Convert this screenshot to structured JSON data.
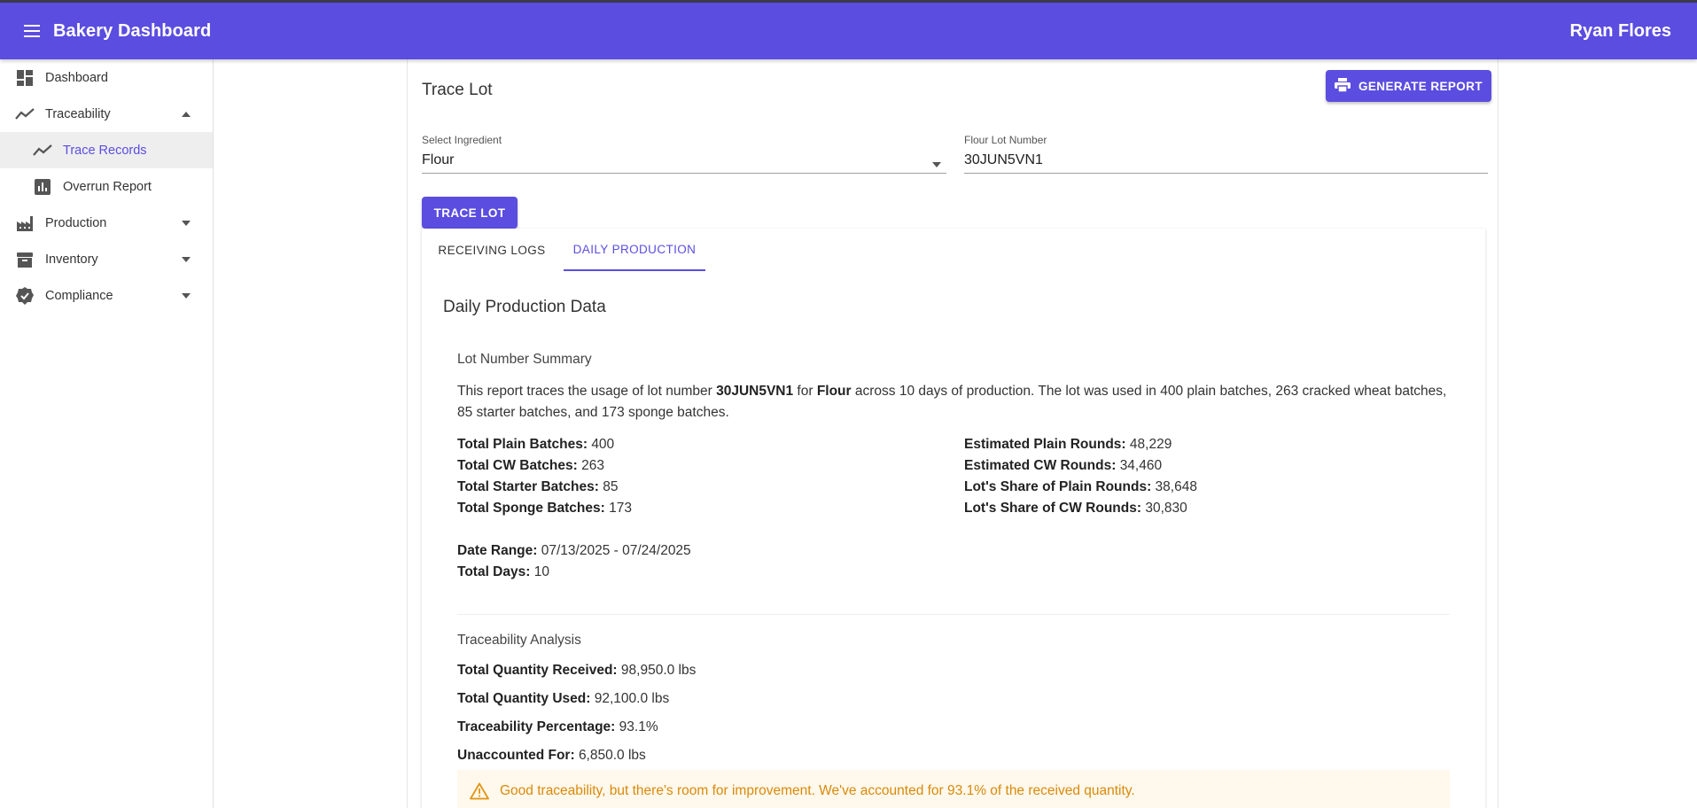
{
  "app": {
    "title": "Bakery Dashboard",
    "user": "Ryan Flores",
    "accent": "#5b4de0"
  },
  "sidebar": {
    "items": [
      {
        "label": "Dashboard",
        "icon": "dashboard-icon"
      },
      {
        "label": "Traceability",
        "icon": "timeline-icon",
        "expanded": true
      },
      {
        "label": "Trace Records",
        "icon": "timeline-icon",
        "active": true
      },
      {
        "label": "Overrun Report",
        "icon": "bar-chart-icon"
      },
      {
        "label": "Production",
        "icon": "factory-icon"
      },
      {
        "label": "Inventory",
        "icon": "archive-icon"
      },
      {
        "label": "Compliance",
        "icon": "verified-icon"
      }
    ]
  },
  "main": {
    "title": "Trace Lot",
    "generate_label": "GENERATE REPORT",
    "ingredient_label": "Select Ingredient",
    "ingredient_value": "Flour",
    "lot_label": "Flour Lot Number",
    "lot_value": "30JUN5VN1",
    "trace_label": "TRACE LOT",
    "tabs": [
      {
        "label": "RECEIVING LOGS",
        "active": false
      },
      {
        "label": "DAILY PRODUCTION",
        "active": true
      }
    ]
  },
  "report": {
    "title": "Daily Production Data",
    "summary_title": "Lot Number Summary",
    "summary": {
      "p1": "This report traces the usage of lot number ",
      "lot": "30JUN5VN1",
      "p2": " for ",
      "ingredient": "Flour",
      "p3": " across 10 days of production. The lot was used in 400 plain batches, 263 cracked wheat batches, 85 starter batches, and 173 sponge batches."
    },
    "left_stats": [
      {
        "label": "Total Plain Batches:",
        "value": "400"
      },
      {
        "label": "Total CW Batches:",
        "value": "263"
      },
      {
        "label": "Total Starter Batches:",
        "value": "85"
      },
      {
        "label": "Total Sponge Batches:",
        "value": "173"
      }
    ],
    "right_stats": [
      {
        "label": "Estimated Plain Rounds:",
        "value": "48,229"
      },
      {
        "label": "Estimated CW Rounds:",
        "value": "34,460"
      },
      {
        "label": "Lot's Share of Plain Rounds:",
        "value": "38,648"
      },
      {
        "label": "Lot's Share of CW Rounds:",
        "value": "30,830"
      }
    ],
    "date_stats": [
      {
        "label": "Date Range:",
        "value": "07/13/2025 - 07/24/2025"
      },
      {
        "label": "Total Days:",
        "value": "10"
      }
    ],
    "analysis_title": "Traceability Analysis",
    "analysis": [
      {
        "label": "Total Quantity Received:",
        "value": "98,950.0 lbs"
      },
      {
        "label": "Total Quantity Used:",
        "value": "92,100.0 lbs"
      },
      {
        "label": "Traceability Percentage:",
        "value": "93.1%"
      },
      {
        "label": "Unaccounted For:",
        "value": "6,850.0 lbs"
      }
    ],
    "alert": "Good traceability, but there's room for improvement. We've accounted for 93.1% of the received quantity."
  }
}
